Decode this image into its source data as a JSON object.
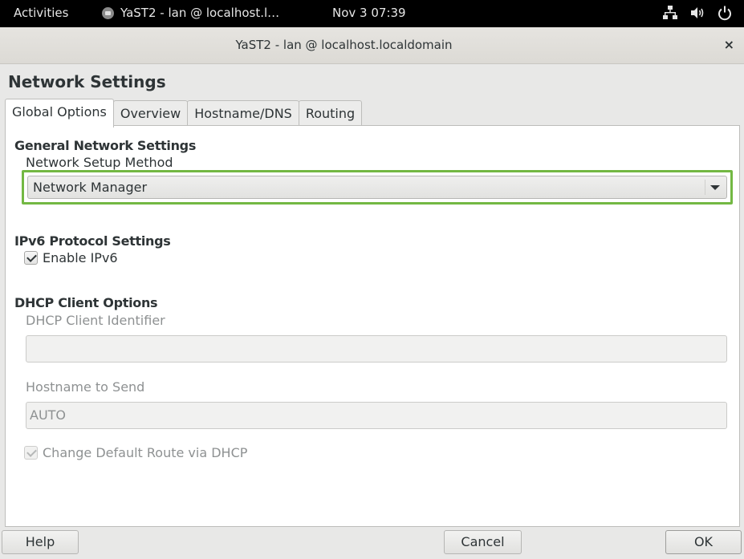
{
  "topbar": {
    "activities": "Activities",
    "app_title": "YaST2 - lan @ localhost.l…",
    "clock": "Nov 3  07:39",
    "tray_icons": [
      "network-icon",
      "volume-icon",
      "power-icon"
    ]
  },
  "window": {
    "title": "YaST2 - lan @ localhost.localdomain",
    "close_label": "×"
  },
  "page_title": "Network Settings",
  "tabs": [
    {
      "label": "Global Options",
      "mnemonic": "G",
      "active": true
    },
    {
      "label": "Overview",
      "mnemonic": "v",
      "active": false
    },
    {
      "label": "Hostname/DNS",
      "mnemonic": "s",
      "active": false
    },
    {
      "label": "Routing",
      "mnemonic": "u",
      "active": false
    }
  ],
  "general": {
    "heading": "General Network Settings",
    "setup_method_label": "Network Setup Method",
    "setup_method_value": "Network Manager",
    "highlight_color": "#73b843"
  },
  "ipv6": {
    "heading": "IPv6 Protocol Settings",
    "enable_label": "Enable IPv6",
    "enabled": true
  },
  "dhcp": {
    "heading": "DHCP Client Options",
    "client_id_label": "DHCP Client Identifier",
    "client_id_value": "",
    "hostname_label": "Hostname to Send",
    "hostname_value": "AUTO",
    "default_route_label": "Change Default Route via DHCP",
    "default_route_checked": true
  },
  "buttons": {
    "help": "Help",
    "cancel": "Cancel",
    "ok": "OK"
  }
}
